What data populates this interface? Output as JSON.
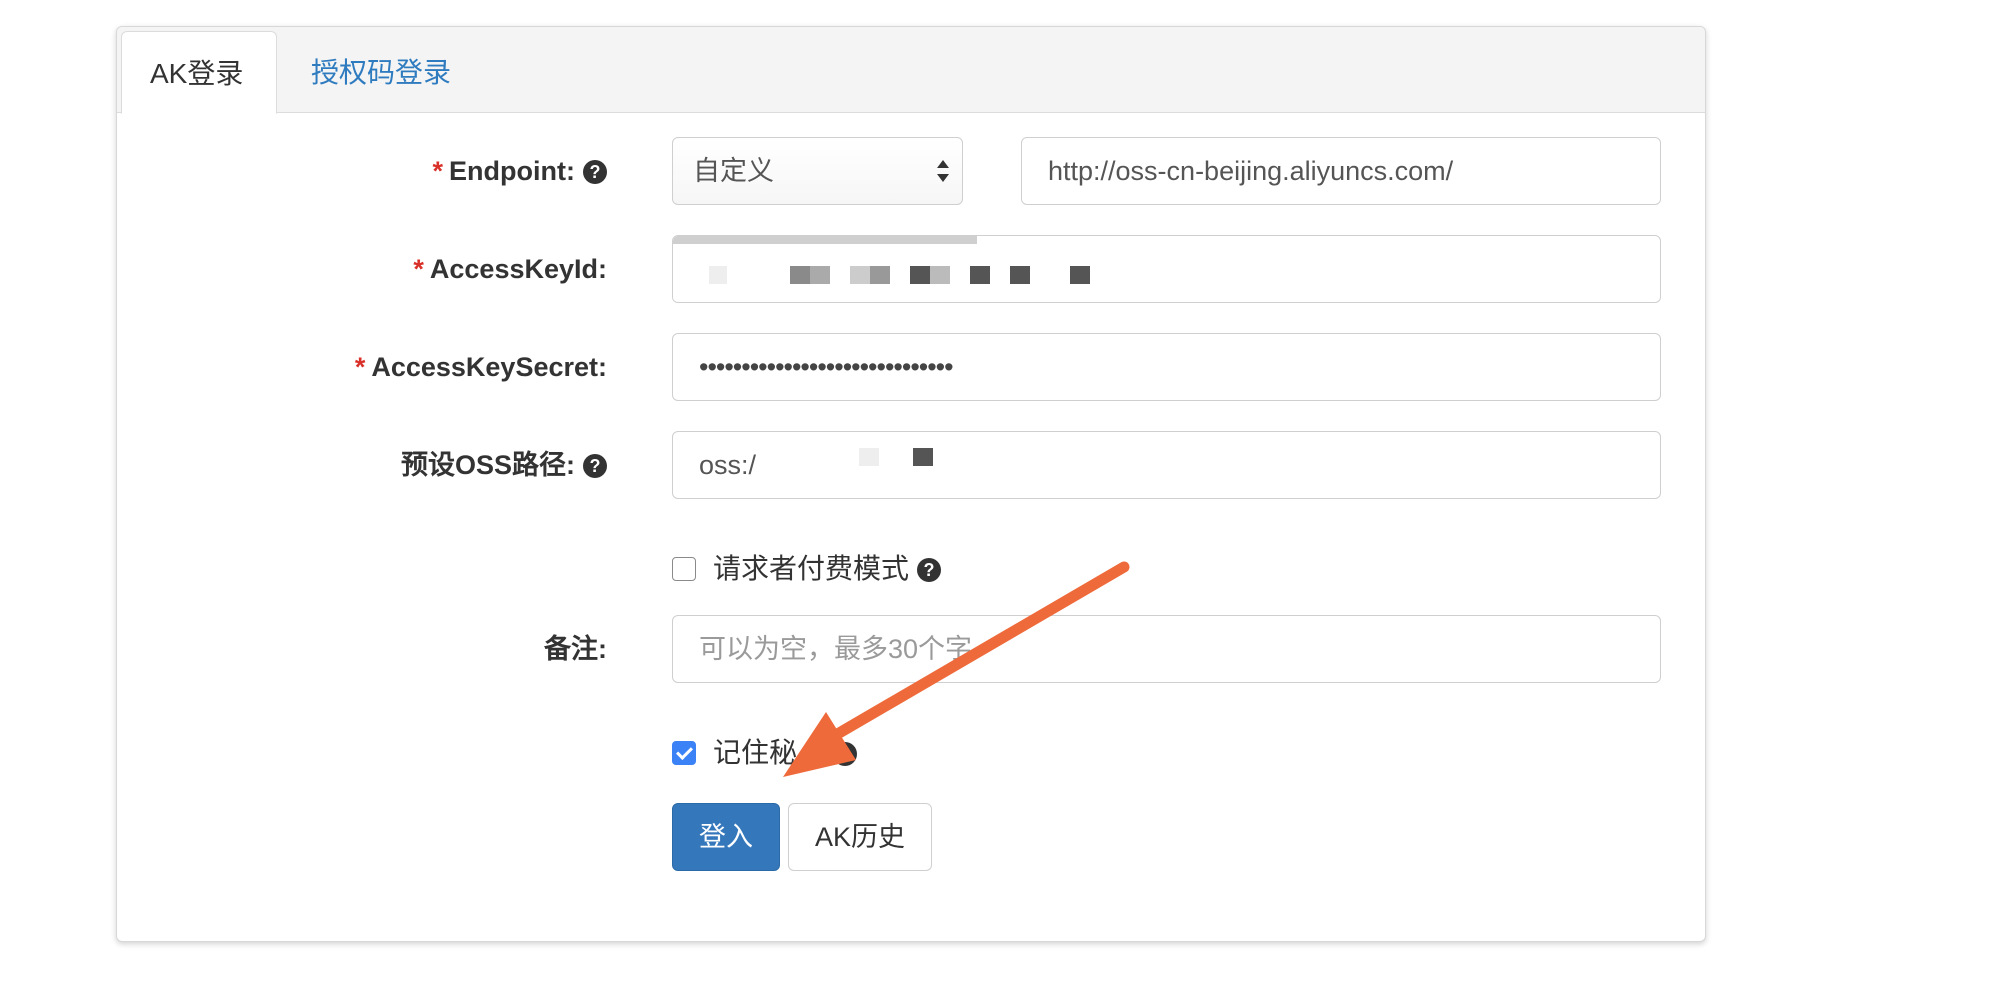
{
  "tabs": [
    {
      "label": "AK登录",
      "active": true
    },
    {
      "label": "授权码登录",
      "active": false
    }
  ],
  "form": {
    "required_mark": "*",
    "help_icon": "?",
    "endpoint": {
      "label": "Endpoint:",
      "select_value": "自定义",
      "url_value": "http://oss-cn-beijing.aliyuncs.com/"
    },
    "access_key_id": {
      "label": "AccessKeyId:"
    },
    "access_key_secret": {
      "label": "AccessKeySecret:",
      "value": "••••••••••••••••••••••••••••••"
    },
    "oss_path": {
      "label": "预设OSS路径:",
      "value": "oss:/"
    },
    "requester_pays": {
      "label": "请求者付费模式",
      "checked": false
    },
    "remark": {
      "label": "备注:",
      "placeholder": "可以为空，最多30个字"
    },
    "remember": {
      "label": "记住秘",
      "checked": true
    }
  },
  "buttons": {
    "login": "登入",
    "history": "AK历史"
  },
  "colors": {
    "primary": "#3477bb",
    "link": "#2f7bbf",
    "required": "#d9302a",
    "annotation_arrow": "#ef6a3a",
    "checkbox": "#3b82f6"
  },
  "annotation": {
    "icon": "arrow-icon"
  }
}
